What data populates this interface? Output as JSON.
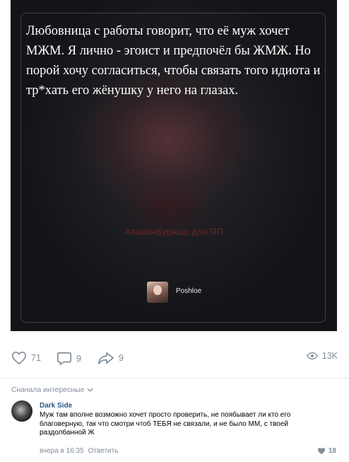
{
  "post": {
    "text": "Любовница с работы говорит, что её муж хочет МЖМ. Я лично - эгоист и предпочёл бы ЖМЖ. Но порой хочу согласиться, чтобы связать того идиота и тр*хать его жёнушку у него на глазах.",
    "watermark": "АтаманБурнаш для ЯП",
    "source_name": "Poshloe"
  },
  "actions": {
    "likes": "71",
    "comments": "9",
    "shares": "9",
    "views": "13K"
  },
  "comments_section": {
    "sort_label": "Сначала интересные",
    "comments": [
      {
        "author": "Dark Side",
        "text": "Муж там вполне возможно хочет просто проверить, не поябывает ли кто его благоверную, так что смотри чтоб ТЕБЯ не связали, и не было ММ, с твоей раздолбанной Ж",
        "time": "вчера в 16:35",
        "reply_label": "Ответить",
        "likes": "18"
      }
    ]
  },
  "colors": {
    "link": "#2a5885",
    "muted": "#818c99",
    "image_bg": "#141418"
  }
}
